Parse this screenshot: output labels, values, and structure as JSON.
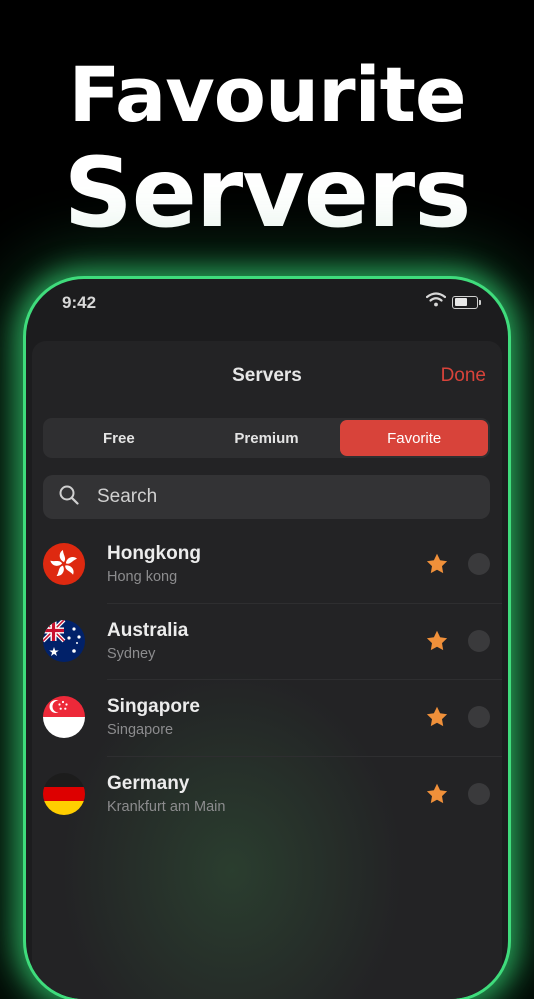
{
  "headline": {
    "line1": "Favourite",
    "line2": "Servers"
  },
  "status_bar": {
    "time": "9:42",
    "battery_level": 0.6
  },
  "header": {
    "title": "Servers",
    "done_label": "Done"
  },
  "tabs": [
    {
      "label": "Free",
      "active": false
    },
    {
      "label": "Premium",
      "active": false
    },
    {
      "label": "Favorite",
      "active": true
    }
  ],
  "search": {
    "placeholder": "Search"
  },
  "servers": [
    {
      "name": "Hongkong",
      "city": "Hong kong",
      "flag": "hong-kong-flag-icon",
      "favorite": true,
      "selected": false
    },
    {
      "name": "Australia",
      "city": "Sydney",
      "flag": "australia-flag-icon",
      "favorite": true,
      "selected": false
    },
    {
      "name": "Singapore",
      "city": "Singapore",
      "flag": "singapore-flag-icon",
      "favorite": true,
      "selected": false
    },
    {
      "name": "Germany",
      "city": "Krankfurt am Main",
      "flag": "germany-flag-icon",
      "favorite": true,
      "selected": false
    }
  ],
  "colors": {
    "accent": "#d8433a",
    "star": "#f0903a",
    "glow": "#3fdc7c"
  }
}
